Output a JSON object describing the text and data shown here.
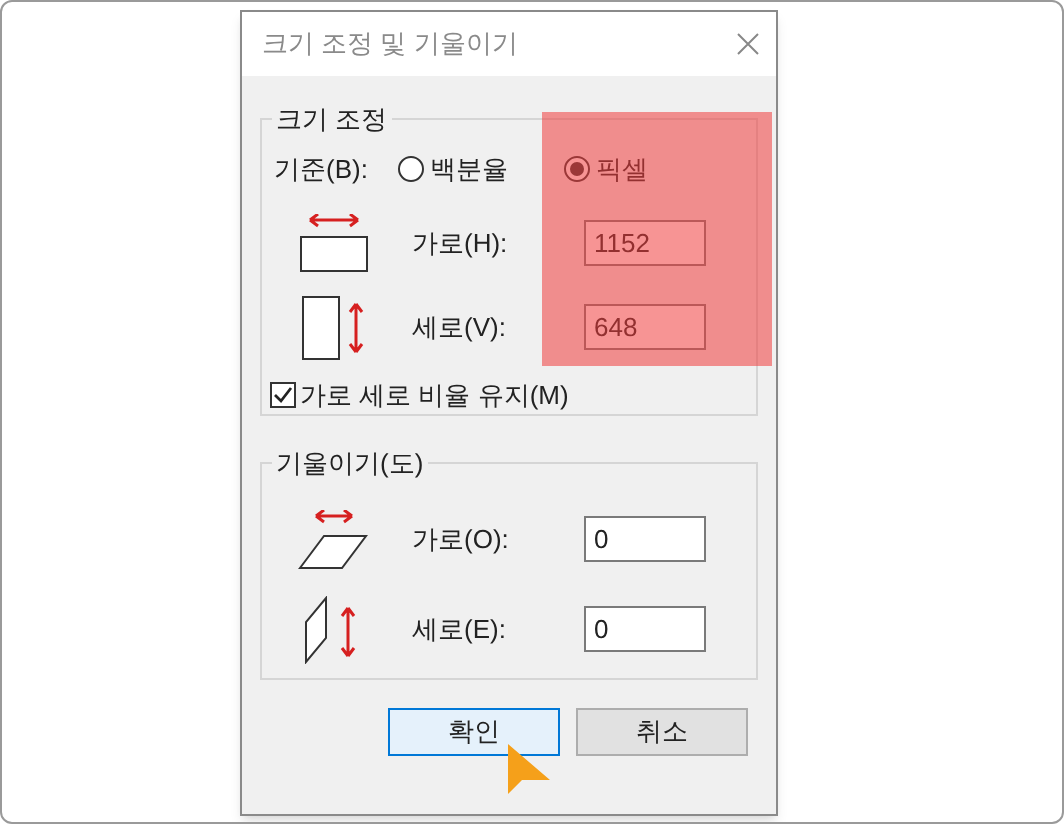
{
  "window": {
    "title": "크기 조정 및 기울이기"
  },
  "resize": {
    "title": "크기 조정",
    "basis_label": "기준(B):",
    "options": [
      {
        "label": "백분율",
        "selected": false
      },
      {
        "label": "픽셀",
        "selected": true
      }
    ],
    "fields": [
      {
        "kind": "horizontal",
        "label": "가로(H):",
        "value": "1152"
      },
      {
        "kind": "vertical",
        "label": "세로(V):",
        "value": "648"
      }
    ],
    "keep_ratio": {
      "label": "가로 세로 비율 유지(M)",
      "checked": true
    }
  },
  "skew": {
    "title": "기울이기(도)",
    "fields": [
      {
        "kind": "horizontal",
        "label": "가로(O):",
        "value": "0"
      },
      {
        "kind": "vertical",
        "label": "세로(E):",
        "value": "0"
      }
    ]
  },
  "buttons": [
    {
      "label": "확인",
      "focused": true
    },
    {
      "label": "취소",
      "focused": false
    }
  ]
}
